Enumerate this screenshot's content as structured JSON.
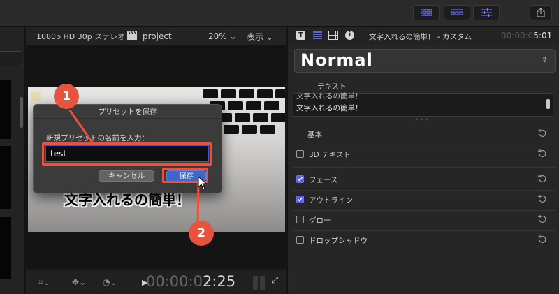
{
  "viewer": {
    "format": "1080p HD 30p ステレオ",
    "project_name": "project",
    "zoom": "20%",
    "view_menu": "表示",
    "caption_text": "文字入れるの簡単！",
    "timecode_dim": "00:00:0",
    "timecode_lit": "2:25"
  },
  "dialog": {
    "title": "プリセットを保存",
    "prompt": "新規プリセットの名前を入力：",
    "input_value": "test",
    "cancel_label": "キャンセル",
    "save_label": "保存"
  },
  "annotations": {
    "badge1": "1",
    "badge2": "2",
    "color": "#e8533f"
  },
  "inspector": {
    "title": "文字入れるの簡単！ - カスタム",
    "duration_dim": "00:00:0",
    "duration_lit": "5:01",
    "style_preset": "Normal",
    "text_section_label": "テキスト",
    "text_line_1": "文字入れるの簡単！",
    "text_line_2": "文字入れるの簡単！",
    "section_basic": "基本",
    "items": [
      {
        "label": "3D テキスト",
        "checked": false
      },
      {
        "label": "フェース",
        "checked": true
      },
      {
        "label": "アウトライン",
        "checked": true
      },
      {
        "label": "グロー",
        "checked": false
      },
      {
        "label": "ドロップシャドウ",
        "checked": false
      }
    ]
  },
  "colors": {
    "accent": "#5b5fe0",
    "annotation": "#e8533f",
    "save_button": "#3f66c9"
  }
}
